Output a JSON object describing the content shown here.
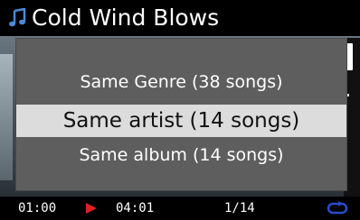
{
  "header": {
    "title": "Cold Wind Blows",
    "icon": "music-note-icon"
  },
  "popup": {
    "items": [
      {
        "label": "Same Genre (38 songs)",
        "selected": false
      },
      {
        "label": "Same artist (14 songs)",
        "selected": true
      },
      {
        "label": "Same album (14 songs)",
        "selected": false
      }
    ]
  },
  "status": {
    "elapsed": "01:00",
    "total": "04:01",
    "track": "1/14",
    "play_icon": "play-icon",
    "repeat_icon": "repeat-icon"
  },
  "colors": {
    "popup_bg": "#5e5e5e",
    "selected_bg": "#dcdcdc",
    "accent_play": "#e02020",
    "repeat": "#2a4cc8",
    "note_icon": "#4a8ad8"
  }
}
